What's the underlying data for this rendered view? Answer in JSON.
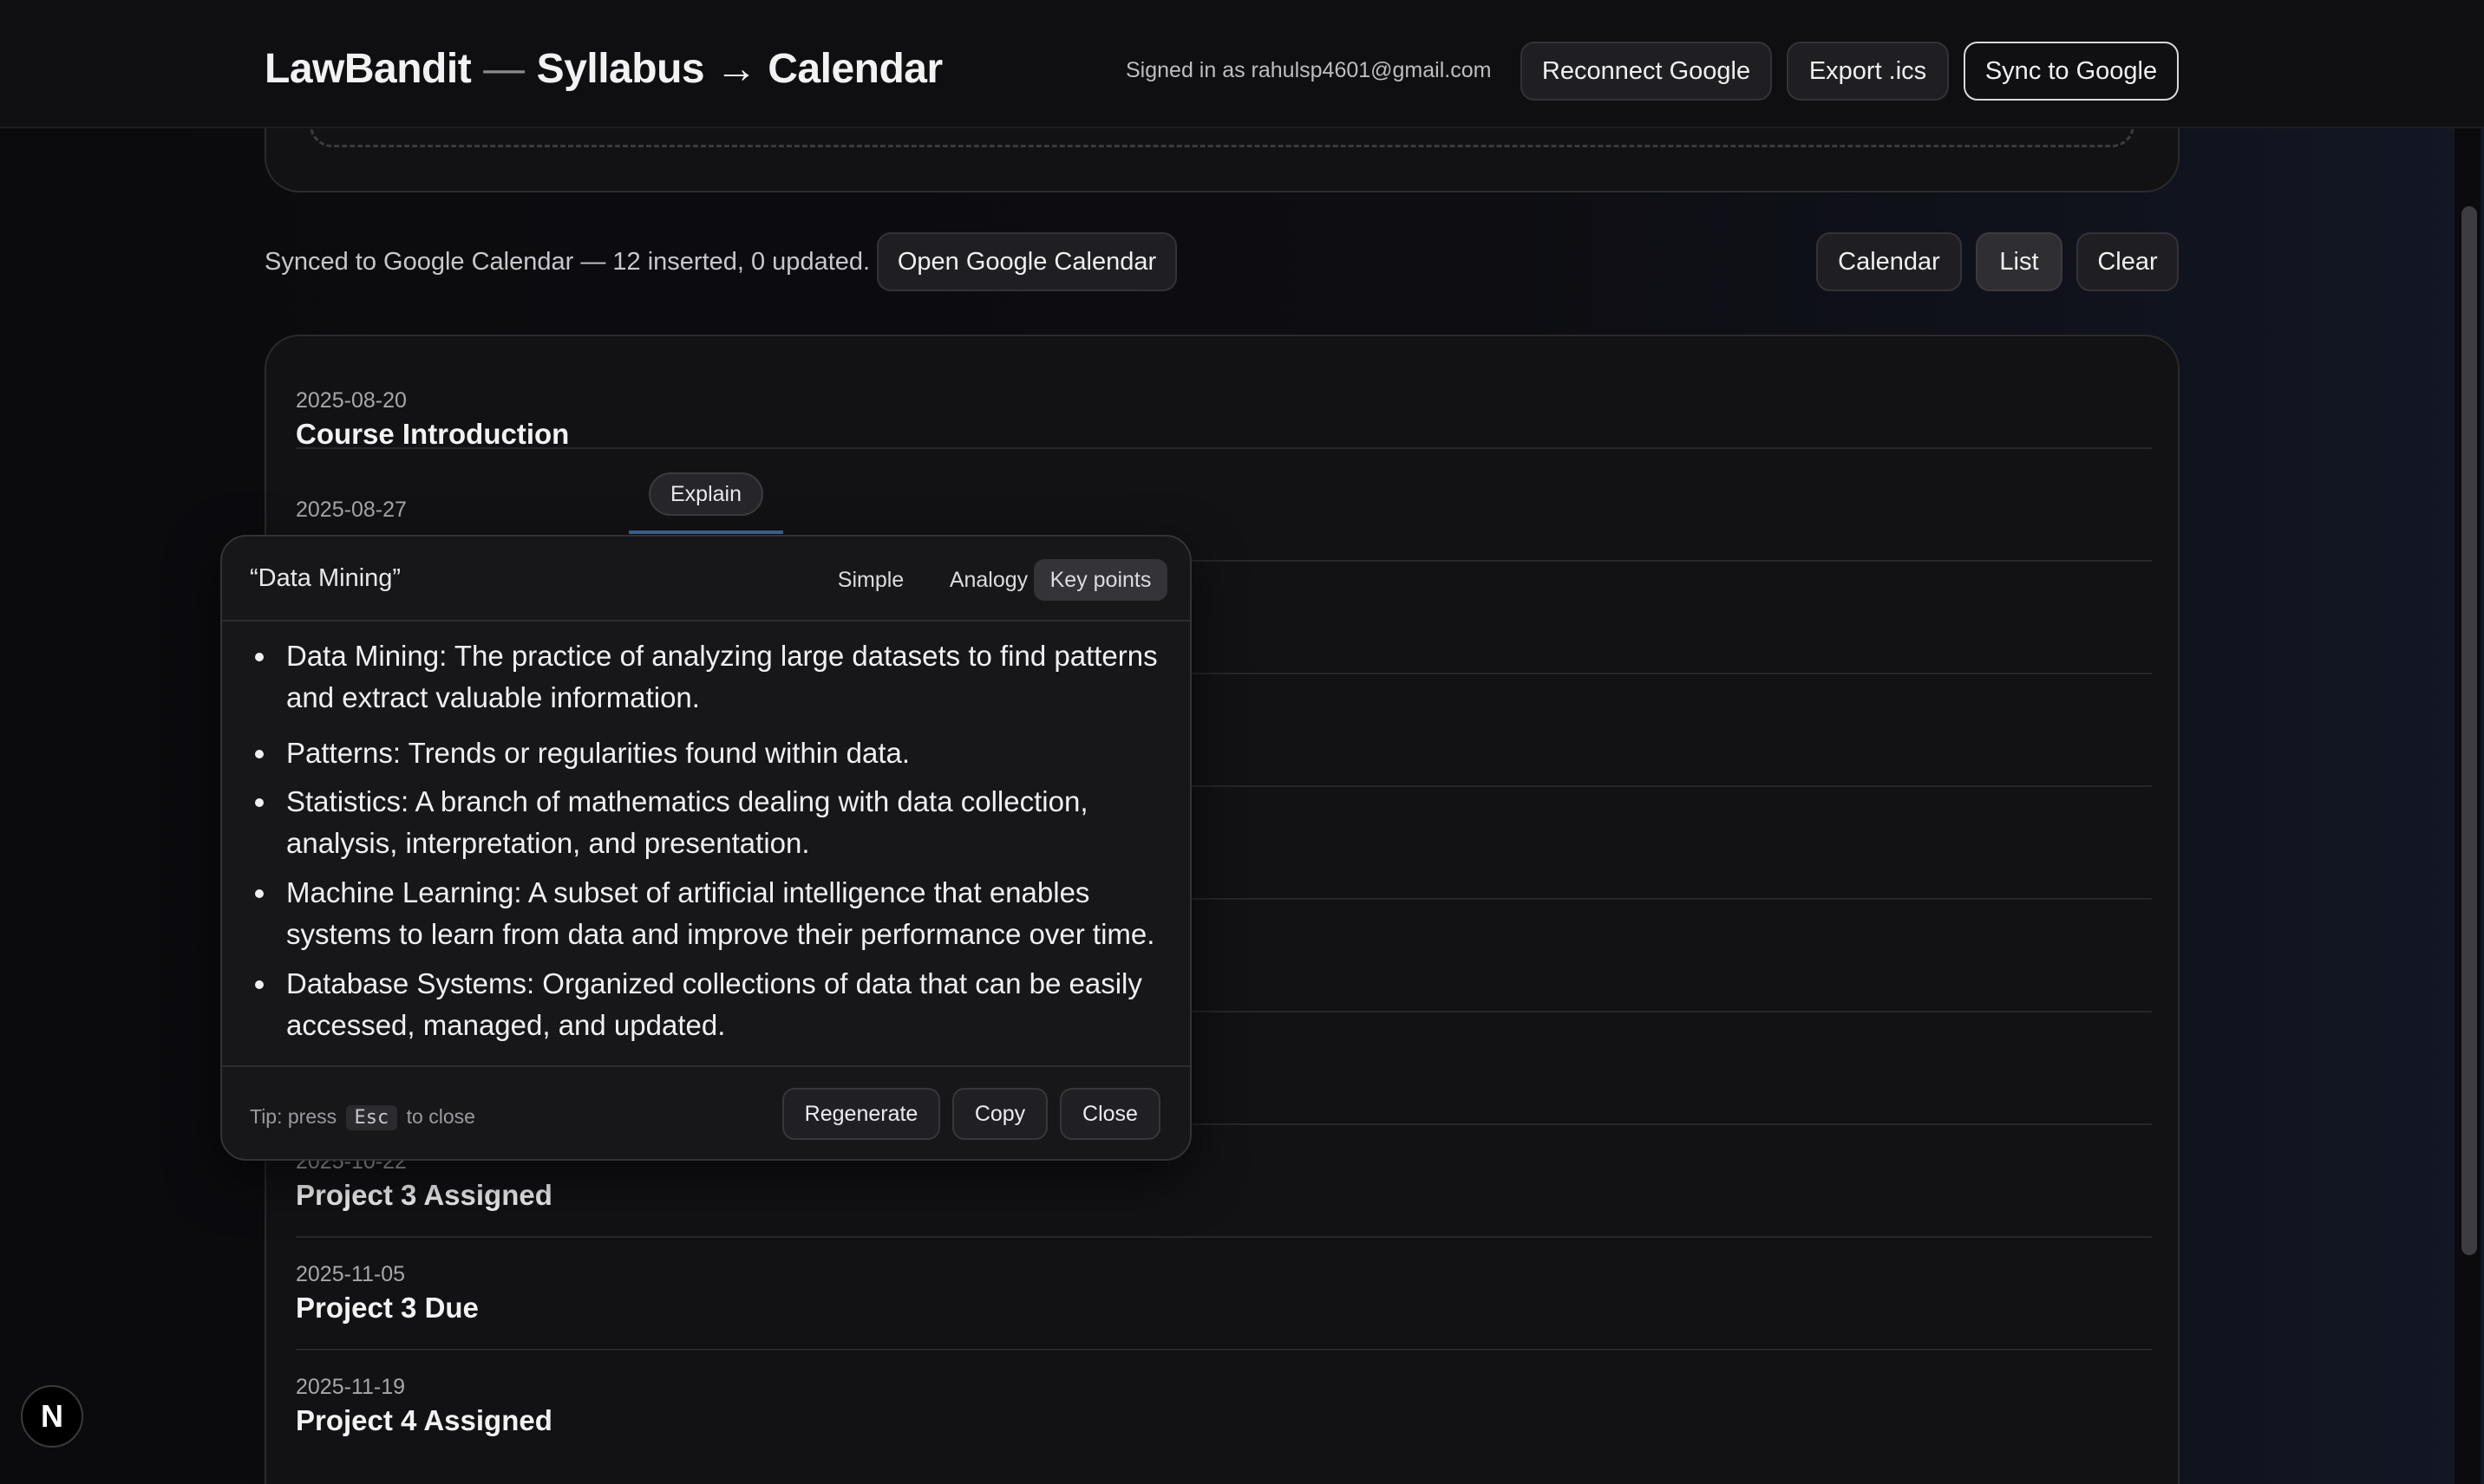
{
  "header": {
    "app_name": "LawBandit",
    "separator": "—",
    "subtitle": "Syllabus → Calendar",
    "signed_in": "Signed in as rahulsp4601@gmail.com",
    "reconnect_label": "Reconnect Google",
    "export_label": "Export .ics",
    "sync_label": "Sync to Google"
  },
  "status": {
    "sync_message": "Synced to Google Calendar — 12 inserted, 0 updated.",
    "open_calendar_label": "Open Google Calendar"
  },
  "view_toggle": {
    "calendar_label": "Calendar",
    "list_label": "List",
    "clear_label": "Clear",
    "active": "List"
  },
  "events": [
    {
      "date": "2025-08-20",
      "title": "Course Introduction"
    },
    {
      "date": "2025-08-27",
      "title": ""
    },
    {
      "date": "2025-10-22",
      "title": "Project 3 Assigned"
    },
    {
      "date": "2025-11-05",
      "title": "Project 3 Due"
    },
    {
      "date": "2025-11-19",
      "title": "Project 4 Assigned"
    }
  ],
  "explain": {
    "chip_label": "Explain",
    "term": "“Data Mining”",
    "modes": [
      "Simple",
      "Analogy",
      "Key points"
    ],
    "selected_mode": "Key points",
    "points": [
      "Data Mining: The practice of analyzing large datasets to find patterns and extract valuable information.",
      "Patterns: Trends or regularities found within data.",
      "Statistics: A branch of mathematics dealing with data collection, analysis, interpretation, and presentation.",
      "Machine Learning: A subset of artificial intelligence that enables systems to learn from data and improve their performance over time.",
      "Database Systems: Organized collections of data that can be easily accessed, managed, and updated."
    ],
    "tip_prefix": "Tip: press",
    "tip_key": "Esc",
    "tip_suffix": "to close",
    "regenerate_label": "Regenerate",
    "copy_label": "Copy",
    "close_label": "Close"
  },
  "dev_badge": "N"
}
